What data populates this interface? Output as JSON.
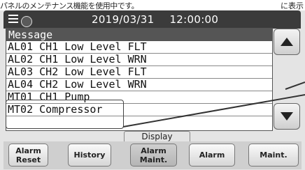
{
  "top_note": {
    "left": "パネルのメンテナンス機能を使用中です。",
    "right": "に表示"
  },
  "header": {
    "date": "2019/03/31",
    "time": "12:00:00"
  },
  "message_list": {
    "header": "Message",
    "rows": [
      "AL01 CH1 Low Level FLT",
      "AL02 CH1 Low Level WRN",
      "AL03 CH2 Low Level FLT",
      "AL04 CH2 Low Level WRN",
      "MT01 CH1 Pump",
      "MT02 Compressor"
    ]
  },
  "display_group_label": "Display",
  "buttons": {
    "alarm_reset_line1": "Alarm",
    "alarm_reset_line2": "Reset",
    "history": "History",
    "alarm_maint_line1": "Alarm",
    "alarm_maint_line2": "Maint.",
    "alarm": "Alarm",
    "maint": "Maint."
  },
  "colors": {
    "header_bg": "#3b3b3b",
    "message_header_bg": "#555555",
    "active_button": "#b5b5b5"
  },
  "icons": {
    "menu": "menu-icon",
    "scroll_up": "triangle-up-icon",
    "scroll_down": "triangle-down-icon"
  }
}
